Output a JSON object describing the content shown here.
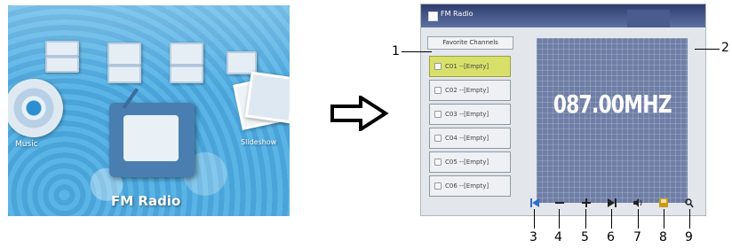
{
  "home_menu": {
    "items": [
      {
        "label": "Music"
      },
      {
        "label": "FM Radio"
      },
      {
        "label": "Slideshow"
      }
    ]
  },
  "fm_screen": {
    "title": "FM Radio",
    "favorites_header": "Favorite Channels",
    "channels": [
      {
        "label": "C01 --[Empty]",
        "selected": true
      },
      {
        "label": "C02 --[Empty]",
        "selected": false
      },
      {
        "label": "C03 --[Empty]",
        "selected": false
      },
      {
        "label": "C04 --[Empty]",
        "selected": false
      },
      {
        "label": "C05 --[Empty]",
        "selected": false
      },
      {
        "label": "C06 --[Empty]",
        "selected": false
      }
    ],
    "frequency": "087.00MHZ",
    "controls": [
      {
        "icon": "previous-icon",
        "color": "#2f6bd0"
      },
      {
        "icon": "minus-icon",
        "color": "#222222"
      },
      {
        "icon": "plus-icon",
        "color": "#222222"
      },
      {
        "icon": "next-icon",
        "color": "#222222"
      },
      {
        "icon": "volume-icon",
        "color": "#222222"
      },
      {
        "icon": "save-icon",
        "color": "#c89a18"
      },
      {
        "icon": "search-icon",
        "color": "#222222"
      }
    ]
  },
  "callouts": {
    "favorites": "1",
    "display": "2",
    "previous": "3",
    "minus": "4",
    "plus": "5",
    "next": "6",
    "volume": "7",
    "save": "8",
    "search": "9"
  }
}
